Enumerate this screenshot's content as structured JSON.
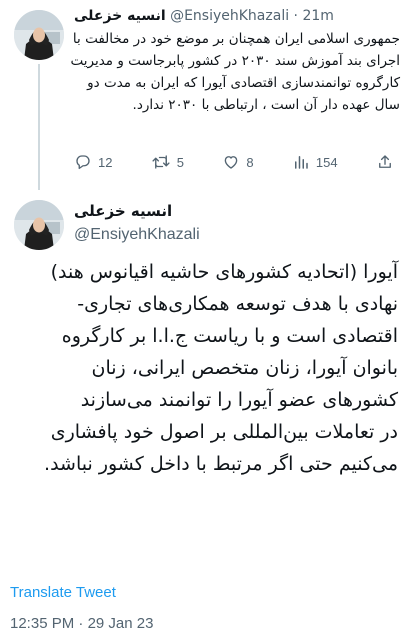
{
  "tweet1": {
    "author_name": "انسیه خزعلی",
    "handle": "@EnsiyehKhazali",
    "separator": "·",
    "time": "21m",
    "text": "جمهوری اسلامی ایران همچنان بر موضع خود در مخالفت با اجرای بند آموزش سند ۲۰۳۰ در کشور پابرجاست و مدیریت کارگروه توانمندسازی اقتصادی آیورا که ایران به مدت دو سال عهده دار آن است ، ارتباطی با ۲۰۳۰ ندارد.",
    "actions": {
      "replies": "12",
      "retweets": "5",
      "likes": "8",
      "views": "154"
    }
  },
  "tweet2": {
    "author_name": "انسیه خزعلی",
    "handle": "@EnsiyehKhazali",
    "paragraphs": [
      "آیورا (اتحادیه کشورهای حاشیه اقیانوس هند) نهادی با هدف توسعه همکاری‌های تجاری-اقتصادی است و با ریاست ج.ا.ا بر کارگروه بانوان آیورا، زنان متخصص ایرانی، زنان کشورهای عضو آیورا را توانمند می‌سازند",
      "در تعاملات بین‌المللی بر اصول خود پافشاری می‌کنیم حتی اگر مرتبط با داخل کشور نباشد."
    ],
    "translate_label": "Translate Tweet",
    "time": "12:35 PM",
    "separator": "·",
    "date": "29 Jan 23"
  },
  "colors": {
    "text": "#0f1419",
    "secondary": "#536471",
    "link": "#1d9bf0",
    "thread_line": "#cfd9de"
  }
}
